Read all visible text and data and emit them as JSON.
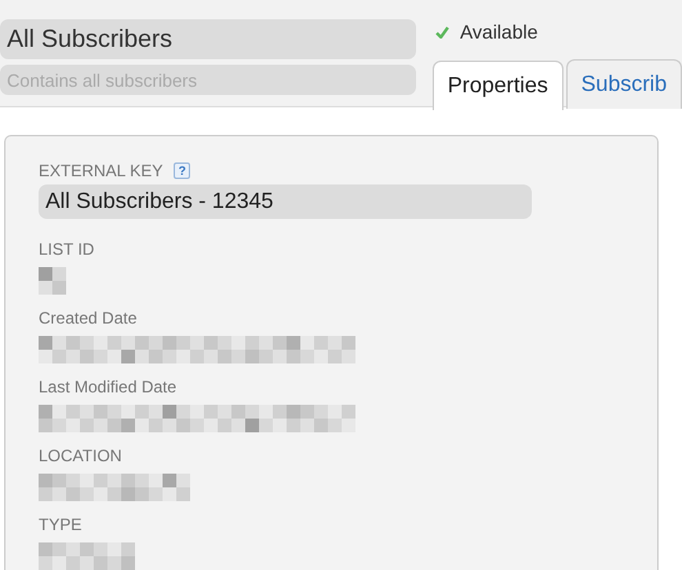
{
  "header": {
    "name": {
      "value": "All Subscribers"
    },
    "description": {
      "placeholder": "Contains all subscribers"
    },
    "status": {
      "label": "Available"
    }
  },
  "tabs": [
    {
      "label": "Properties",
      "selected": true
    },
    {
      "label": "Subscrib",
      "selected": false
    }
  ],
  "properties": [
    {
      "label": "EXTERNAL KEY",
      "kind": "input",
      "value": "All Subscribers - 12345",
      "help": "?"
    },
    {
      "label": "LIST ID",
      "kind": "redacted"
    },
    {
      "label": "Created Date",
      "kind": "redacted"
    },
    {
      "label": "Last Modified Date",
      "kind": "redacted"
    },
    {
      "label": "LOCATION",
      "kind": "redacted"
    },
    {
      "label": "TYPE",
      "kind": "redacted"
    }
  ]
}
